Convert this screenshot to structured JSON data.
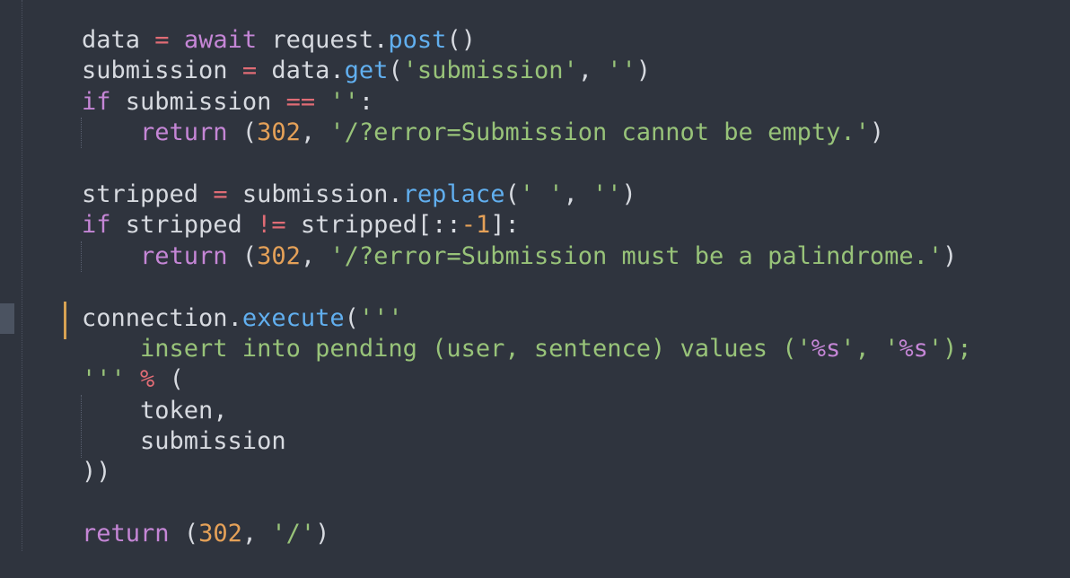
{
  "editor": {
    "language": "python",
    "colors": {
      "background": "#2f343e",
      "text": "#d7dae0",
      "keyword": "#c586d6",
      "operator": "#e06c75",
      "function": "#61afef",
      "string": "#98c379",
      "number": "#e5a158",
      "modified_marker": "#d7a253",
      "gutter_marker": "#4b5361"
    },
    "lines": [
      [
        {
          "t": "plain",
          "s": "data "
        },
        {
          "t": "op",
          "s": "="
        },
        {
          "t": "plain",
          "s": " "
        },
        {
          "t": "kw",
          "s": "await"
        },
        {
          "t": "plain",
          "s": " request"
        },
        {
          "t": "punc",
          "s": "."
        },
        {
          "t": "fn",
          "s": "post"
        },
        {
          "t": "punc",
          "s": "()"
        }
      ],
      [
        {
          "t": "plain",
          "s": "submission "
        },
        {
          "t": "op",
          "s": "="
        },
        {
          "t": "plain",
          "s": " data"
        },
        {
          "t": "punc",
          "s": "."
        },
        {
          "t": "fn",
          "s": "get"
        },
        {
          "t": "punc",
          "s": "("
        },
        {
          "t": "str",
          "s": "'submission'"
        },
        {
          "t": "punc",
          "s": ", "
        },
        {
          "t": "str",
          "s": "''"
        },
        {
          "t": "punc",
          "s": ")"
        }
      ],
      [
        {
          "t": "kw",
          "s": "if"
        },
        {
          "t": "plain",
          "s": " submission "
        },
        {
          "t": "op",
          "s": "=="
        },
        {
          "t": "plain",
          "s": " "
        },
        {
          "t": "str",
          "s": "''"
        },
        {
          "t": "punc",
          "s": ":"
        }
      ],
      [
        {
          "t": "plain",
          "s": "    "
        },
        {
          "t": "kw",
          "s": "return"
        },
        {
          "t": "plain",
          "s": " "
        },
        {
          "t": "punc",
          "s": "("
        },
        {
          "t": "num",
          "s": "302"
        },
        {
          "t": "punc",
          "s": ", "
        },
        {
          "t": "str",
          "s": "'/?error=Submission cannot be empty.'"
        },
        {
          "t": "punc",
          "s": ")"
        }
      ],
      [],
      [
        {
          "t": "plain",
          "s": "stripped "
        },
        {
          "t": "op",
          "s": "="
        },
        {
          "t": "plain",
          "s": " submission"
        },
        {
          "t": "punc",
          "s": "."
        },
        {
          "t": "fn",
          "s": "replace"
        },
        {
          "t": "punc",
          "s": "("
        },
        {
          "t": "str",
          "s": "' '"
        },
        {
          "t": "punc",
          "s": ", "
        },
        {
          "t": "str",
          "s": "''"
        },
        {
          "t": "punc",
          "s": ")"
        }
      ],
      [
        {
          "t": "kw",
          "s": "if"
        },
        {
          "t": "plain",
          "s": " stripped "
        },
        {
          "t": "op",
          "s": "!="
        },
        {
          "t": "plain",
          "s": " stripped"
        },
        {
          "t": "punc",
          "s": "[::"
        },
        {
          "t": "num",
          "s": "-1"
        },
        {
          "t": "punc",
          "s": "]:"
        }
      ],
      [
        {
          "t": "plain",
          "s": "    "
        },
        {
          "t": "kw",
          "s": "return"
        },
        {
          "t": "plain",
          "s": " "
        },
        {
          "t": "punc",
          "s": "("
        },
        {
          "t": "num",
          "s": "302"
        },
        {
          "t": "punc",
          "s": ", "
        },
        {
          "t": "str",
          "s": "'/?error=Submission must be a palindrome.'"
        },
        {
          "t": "punc",
          "s": ")"
        }
      ],
      [],
      [
        {
          "t": "plain",
          "s": "connection"
        },
        {
          "t": "punc",
          "s": "."
        },
        {
          "t": "fn",
          "s": "execute"
        },
        {
          "t": "punc",
          "s": "("
        },
        {
          "t": "str",
          "s": "'''"
        }
      ],
      [
        {
          "t": "str",
          "s": "    insert into pending (user, sentence) values ('"
        },
        {
          "t": "esc",
          "s": "%s"
        },
        {
          "t": "str",
          "s": "', '"
        },
        {
          "t": "esc",
          "s": "%s"
        },
        {
          "t": "str",
          "s": "');"
        }
      ],
      [
        {
          "t": "str",
          "s": "'''"
        },
        {
          "t": "plain",
          "s": " "
        },
        {
          "t": "op",
          "s": "%"
        },
        {
          "t": "plain",
          "s": " "
        },
        {
          "t": "punc",
          "s": "("
        }
      ],
      [
        {
          "t": "plain",
          "s": "    token"
        },
        {
          "t": "punc",
          "s": ","
        }
      ],
      [
        {
          "t": "plain",
          "s": "    submission"
        }
      ],
      [
        {
          "t": "punc",
          "s": "))"
        }
      ],
      [],
      [
        {
          "t": "kw",
          "s": "return"
        },
        {
          "t": "plain",
          "s": " "
        },
        {
          "t": "punc",
          "s": "("
        },
        {
          "t": "num",
          "s": "302"
        },
        {
          "t": "punc",
          "s": ", "
        },
        {
          "t": "str",
          "s": "'/'"
        },
        {
          "t": "punc",
          "s": ")"
        }
      ]
    ]
  }
}
